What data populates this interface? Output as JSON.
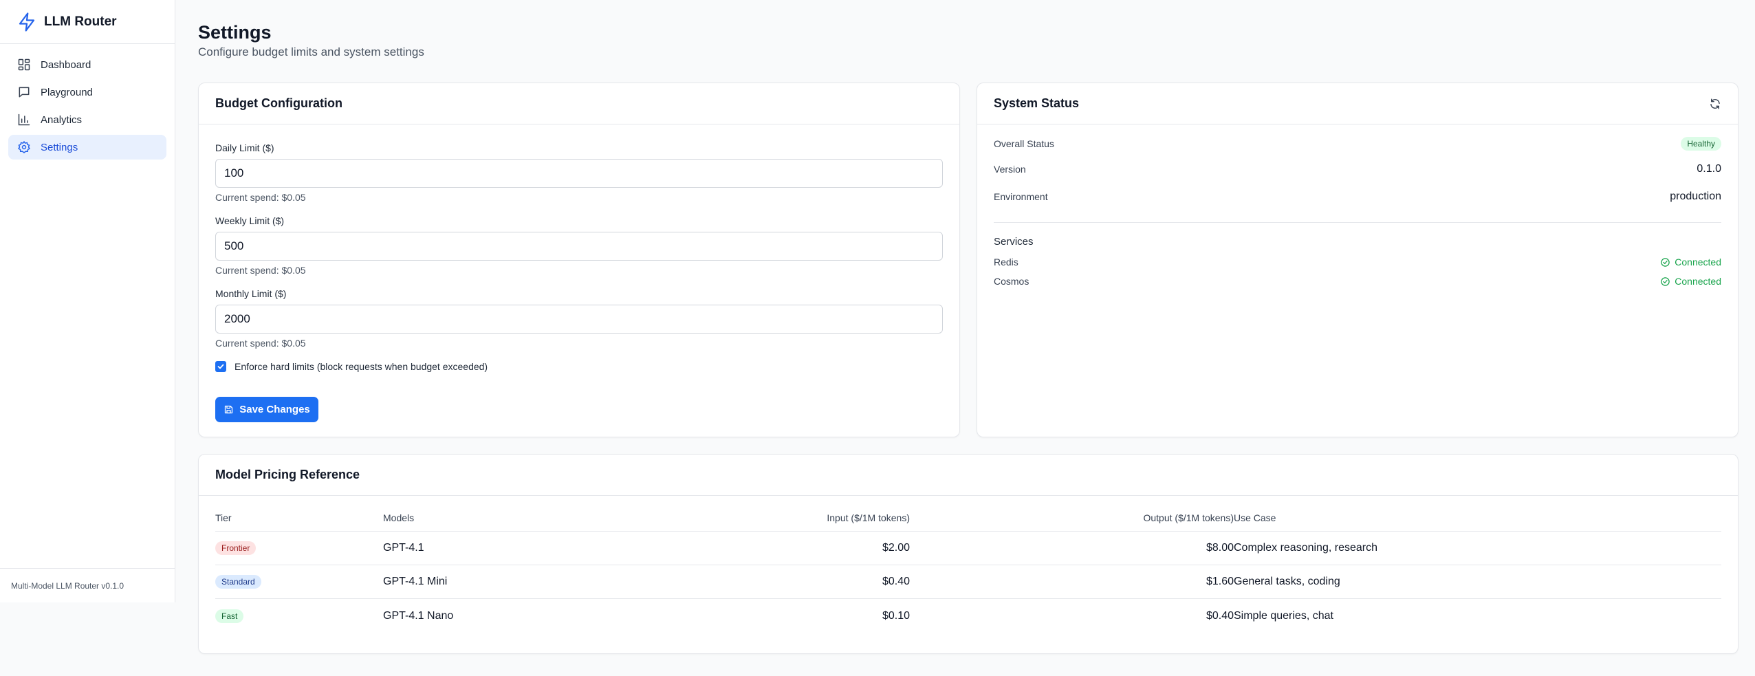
{
  "app": {
    "name": "LLM Router",
    "footer": "Multi-Model LLM Router v0.1.0"
  },
  "nav": {
    "items": [
      {
        "label": "Dashboard",
        "icon": "dashboard-icon"
      },
      {
        "label": "Playground",
        "icon": "chat-icon"
      },
      {
        "label": "Analytics",
        "icon": "bar-chart-icon"
      },
      {
        "label": "Settings",
        "icon": "gear-icon",
        "active": true
      }
    ]
  },
  "page": {
    "title": "Settings",
    "subtitle": "Configure budget limits and system settings"
  },
  "budget": {
    "title": "Budget Configuration",
    "daily": {
      "label": "Daily Limit ($)",
      "value": "100",
      "help": "Current spend: $0.05"
    },
    "weekly": {
      "label": "Weekly Limit ($)",
      "value": "500",
      "help": "Current spend: $0.05"
    },
    "monthly": {
      "label": "Monthly Limit ($)",
      "value": "2000",
      "help": "Current spend: $0.05"
    },
    "enforce_label": "Enforce hard limits (block requests when budget exceeded)",
    "enforce_checked": true,
    "save_label": "Save Changes"
  },
  "status": {
    "title": "System Status",
    "overall_label": "Overall Status",
    "overall_value": "Healthy",
    "version_label": "Version",
    "version_value": "0.1.0",
    "environment_label": "Environment",
    "environment_value": "production",
    "services_title": "Services",
    "services": [
      {
        "name": "Redis",
        "status": "Connected"
      },
      {
        "name": "Cosmos",
        "status": "Connected"
      }
    ]
  },
  "pricing": {
    "title": "Model Pricing Reference",
    "headers": {
      "tier": "Tier",
      "models": "Models",
      "input": "Input ($/1M tokens)",
      "output": "Output ($/1M tokens)",
      "use": "Use Case"
    },
    "rows": [
      {
        "tier": "Frontier",
        "model": "GPT-4.1",
        "input": "$2.00",
        "output": "$8.00",
        "use": "Complex reasoning, research"
      },
      {
        "tier": "Standard",
        "model": "GPT-4.1 Mini",
        "input": "$0.40",
        "output": "$1.60",
        "use": "General tasks, coding"
      },
      {
        "tier": "Fast",
        "model": "GPT-4.1 Nano",
        "input": "$0.10",
        "output": "$0.40",
        "use": "Simple queries, chat"
      }
    ]
  },
  "colors": {
    "accent": "#1d6ff2",
    "success": "#16a34a"
  }
}
